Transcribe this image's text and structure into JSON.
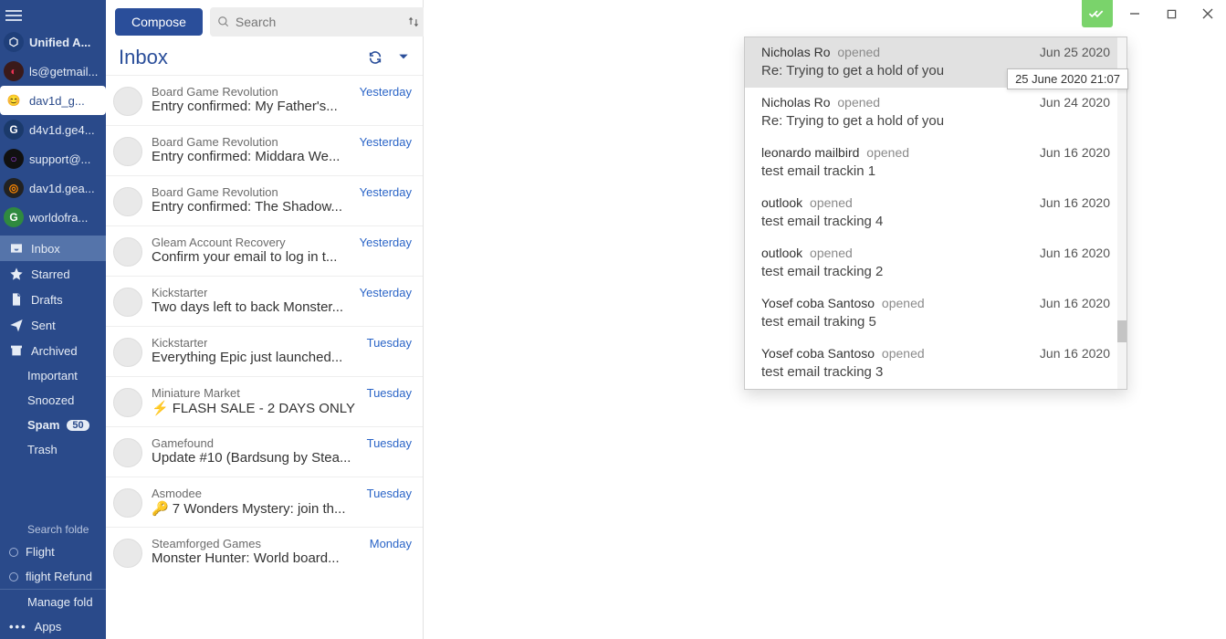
{
  "window_controls": {
    "minimize": "–",
    "maximize": "▢",
    "close": "✕",
    "track_toggle": "✔✔"
  },
  "sidebar": {
    "accounts": [
      {
        "label": "Unified A...",
        "icon_bg": "#1f3f7a",
        "icon_fg": "#fff",
        "icon_char": "⬡",
        "bold": true
      },
      {
        "label": "ls@getmail...",
        "icon_bg": "#3a1a1a",
        "icon_fg": "#e35",
        "icon_char": "◐"
      },
      {
        "label": "dav1d_g...",
        "icon_bg": "#fff",
        "icon_fg": "#555",
        "icon_char": "😊",
        "active": true
      },
      {
        "label": "d4v1d.ge4...",
        "icon_bg": "#1b3a6b",
        "icon_fg": "#fff",
        "icon_char": "G"
      },
      {
        "label": "support@...",
        "icon_bg": "#111",
        "icon_fg": "#a4e",
        "icon_char": "○"
      },
      {
        "label": "dav1d.gea...",
        "icon_bg": "#222",
        "icon_fg": "#f80",
        "icon_char": "◎"
      },
      {
        "label": "worldofra...",
        "icon_bg": "#2f8a3f",
        "icon_fg": "#fff",
        "icon_char": "G"
      }
    ],
    "folders": [
      {
        "icon": "inbox",
        "label": "Inbox",
        "sel": true
      },
      {
        "icon": "star",
        "label": "Starred"
      },
      {
        "icon": "draft",
        "label": "Drafts"
      },
      {
        "icon": "sent",
        "label": "Sent"
      },
      {
        "icon": "archive",
        "label": "Archived"
      },
      {
        "icon": "",
        "label": "Important",
        "indent": true
      },
      {
        "icon": "",
        "label": "Snoozed",
        "indent": true
      },
      {
        "icon": "",
        "label": "Spam",
        "indent": true,
        "bold": true,
        "badge": "50"
      },
      {
        "icon": "",
        "label": "Trash",
        "indent": true
      }
    ],
    "search_header": "Search folde",
    "smart": [
      {
        "label": "Flight"
      },
      {
        "label": "flight Refund"
      }
    ],
    "manage": "Manage fold",
    "apps": "Apps"
  },
  "listpane": {
    "compose": "Compose",
    "search_placeholder": "Search",
    "title": "Inbox",
    "messages": [
      {
        "sender": "Board Game Revolution",
        "date": "Yesterday",
        "subject": "Entry confirmed: My Father's..."
      },
      {
        "sender": "Board Game Revolution",
        "date": "Yesterday",
        "subject": "Entry confirmed: Middara We..."
      },
      {
        "sender": "Board Game Revolution",
        "date": "Yesterday",
        "subject": "Entry confirmed: The Shadow..."
      },
      {
        "sender": "Gleam Account Recovery",
        "date": "Yesterday",
        "subject": "Confirm your email to log in t..."
      },
      {
        "sender": "Kickstarter",
        "date": "Yesterday",
        "subject": "Two days left to back Monster..."
      },
      {
        "sender": "Kickstarter",
        "date": "Tuesday",
        "subject": "Everything Epic just launched..."
      },
      {
        "sender": "Miniature Market",
        "date": "Tuesday",
        "subject": "FLASH SALE - 2 DAYS ONLY",
        "icon": "⚡"
      },
      {
        "sender": "Gamefound",
        "date": "Tuesday",
        "subject": "Update #10 (Bardsung by Stea..."
      },
      {
        "sender": "Asmodee",
        "date": "Tuesday",
        "subject": "7 Wonders Mystery: join th...",
        "icon": "🔑"
      },
      {
        "sender": "Steamforged Games",
        "date": "Monday",
        "subject": "Monster Hunter: World board..."
      }
    ]
  },
  "popup": {
    "tooltip": "25 June 2020 21:07",
    "rows": [
      {
        "name": "Nicholas Ro",
        "state": "opened",
        "date": "Jun 25 2020",
        "subject": "Re: Trying to get a hold of you",
        "sel": true
      },
      {
        "name": "Nicholas Ro",
        "state": "opened",
        "date": "Jun 24 2020",
        "subject": "Re: Trying to get a hold of you"
      },
      {
        "name": "leonardo mailbird",
        "state": "opened",
        "date": "Jun 16 2020",
        "subject": "test email trackin 1"
      },
      {
        "name": "outlook",
        "state": "opened",
        "date": "Jun 16 2020",
        "subject": "test email tracking 4"
      },
      {
        "name": "outlook",
        "state": "opened",
        "date": "Jun 16 2020",
        "subject": "test email tracking 2"
      },
      {
        "name": "Yosef coba Santoso",
        "state": "opened",
        "date": "Jun 16 2020",
        "subject": "test email traking 5"
      },
      {
        "name": "Yosef coba Santoso",
        "state": "opened",
        "date": "Jun 16 2020",
        "subject": "test email tracking 3"
      }
    ]
  }
}
